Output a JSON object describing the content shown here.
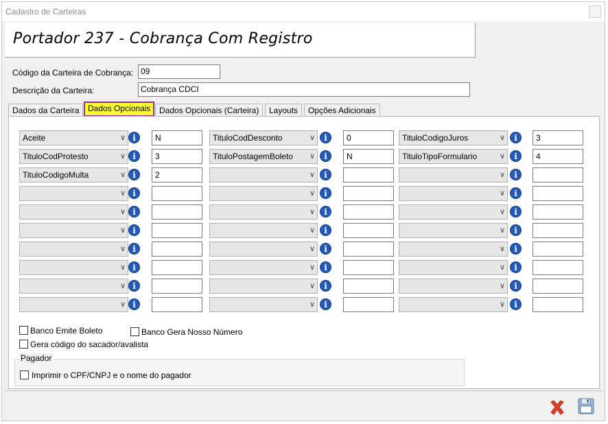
{
  "window": {
    "title": "Cadastro de Carteiras"
  },
  "header": {
    "title": "Portador 237 - Cobrança Com Registro"
  },
  "form": {
    "codigo_label": "Código da Carteira de Cobrança:",
    "codigo_value": "09",
    "descricao_label": "Descrição da Carteira:",
    "descricao_value": "Cobrança CDCI"
  },
  "tabs": [
    {
      "label": "Dados da Carteira"
    },
    {
      "label": "Dados Opcionais",
      "active": true
    },
    {
      "label": "Dados Opcionais (Carteira)"
    },
    {
      "label": "Layouts"
    },
    {
      "label": "Opções Adicionais"
    }
  ],
  "grid": {
    "rows": [
      [
        {
          "field": "Aceite",
          "value": "N"
        },
        {
          "field": "TituloCodDesconto",
          "value": "0"
        },
        {
          "field": "TituloCodigoJuros",
          "value": "3"
        }
      ],
      [
        {
          "field": "TituloCodProtesto",
          "value": "3"
        },
        {
          "field": "TituloPostagemBoleto",
          "value": "N"
        },
        {
          "field": "TituloTipoFormulario",
          "value": "4"
        }
      ],
      [
        {
          "field": "TituloCodigoMulta",
          "value": "2"
        },
        {
          "field": "",
          "value": ""
        },
        {
          "field": "",
          "value": ""
        }
      ],
      [
        {
          "field": "",
          "value": ""
        },
        {
          "field": "",
          "value": ""
        },
        {
          "field": "",
          "value": ""
        }
      ],
      [
        {
          "field": "",
          "value": ""
        },
        {
          "field": "",
          "value": ""
        },
        {
          "field": "",
          "value": ""
        }
      ],
      [
        {
          "field": "",
          "value": ""
        },
        {
          "field": "",
          "value": ""
        },
        {
          "field": "",
          "value": ""
        }
      ],
      [
        {
          "field": "",
          "value": ""
        },
        {
          "field": "",
          "value": ""
        },
        {
          "field": "",
          "value": ""
        }
      ],
      [
        {
          "field": "",
          "value": ""
        },
        {
          "field": "",
          "value": ""
        },
        {
          "field": "",
          "value": ""
        }
      ],
      [
        {
          "field": "",
          "value": ""
        },
        {
          "field": "",
          "value": ""
        },
        {
          "field": "",
          "value": ""
        }
      ],
      [
        {
          "field": "",
          "value": ""
        },
        {
          "field": "",
          "value": ""
        },
        {
          "field": "",
          "value": ""
        }
      ]
    ]
  },
  "options": {
    "banco_emite_boleto": "Banco Emite Boleto",
    "banco_gera_nosso_numero": "Banco Gera Nosso Número",
    "gera_codigo_sacador": "Gera código do sacador/avalista"
  },
  "pagador": {
    "group_label": "Pagador",
    "imprimir_label": "Imprimir o CPF/CNPJ e o nome do pagador"
  },
  "icons": {
    "info": "info-icon",
    "cancel": "close-x-icon",
    "save": "floppy-disk-icon",
    "dropdown": "chevron-down-icon"
  },
  "colors": {
    "active_tab_bg": "#ffff33",
    "active_tab_border": "#8a2ca5",
    "info_icon": "#2359b7",
    "cancel_icon": "#e0402a"
  }
}
